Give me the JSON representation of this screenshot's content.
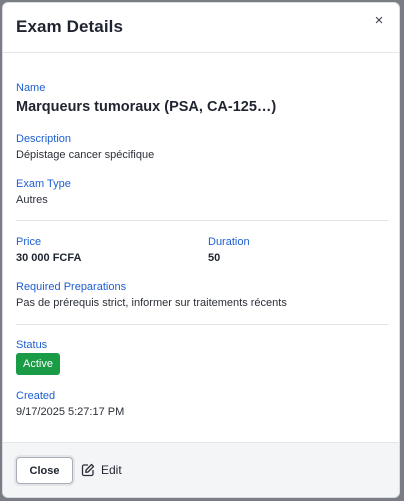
{
  "modal": {
    "title": "Exam Details",
    "close_symbol": "×"
  },
  "fields": {
    "name": {
      "label": "Name",
      "value": "Marqueurs tumoraux (PSA, CA-125…)"
    },
    "description": {
      "label": "Description",
      "value": "Dépistage cancer spécifique"
    },
    "exam_type": {
      "label": "Exam Type",
      "value": "Autres"
    },
    "price": {
      "label": "Price",
      "value": "30 000 FCFA"
    },
    "duration": {
      "label": "Duration",
      "value": "50"
    },
    "required_preparations": {
      "label": "Required Preparations",
      "value": "Pas de prérequis strict, informer sur traitements récents"
    },
    "status": {
      "label": "Status",
      "value": "Active"
    },
    "created": {
      "label": "Created",
      "value": "9/17/2025 5:27:17 PM"
    }
  },
  "footer": {
    "close_label": "Close",
    "edit_label": "Edit",
    "edit_icon": "pencil-square-icon"
  },
  "colors": {
    "label": "#1d5fd0",
    "status_active": "#1a9b45"
  }
}
